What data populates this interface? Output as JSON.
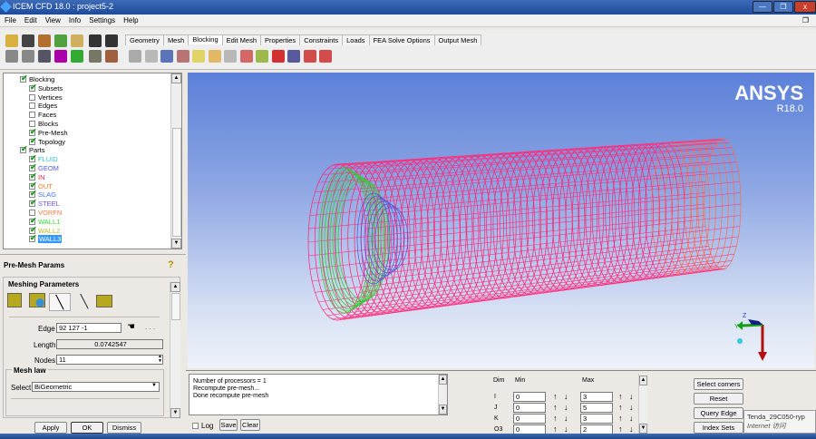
{
  "window": {
    "title": "ICEM CFD 18.0 : project5-2",
    "min": "—",
    "max": "❐",
    "close": "x"
  },
  "menu": [
    "File",
    "Edit",
    "View",
    "Info",
    "Settings",
    "Help"
  ],
  "tabs": [
    "Geometry",
    "Mesh",
    "Blocking",
    "Edit Mesh",
    "Properties",
    "Constraints",
    "Loads",
    "FEA Solve Options",
    "Output Mesh"
  ],
  "active_tab": "Blocking",
  "tree": {
    "blocking": {
      "label": "Blocking",
      "items": [
        {
          "label": "Subsets",
          "checked": true
        },
        {
          "label": "Vertices",
          "checked": false
        },
        {
          "label": "Edges",
          "checked": false
        },
        {
          "label": "Faces",
          "checked": false
        },
        {
          "label": "Blocks",
          "checked": false
        },
        {
          "label": "Pre-Mesh",
          "checked": true
        },
        {
          "label": "Topology",
          "checked": true
        }
      ]
    },
    "parts": {
      "label": "Parts",
      "items": [
        {
          "label": "FLUID",
          "checked": true,
          "color": "#33c0c0"
        },
        {
          "label": "GEOM",
          "checked": true,
          "color": "#5555ee"
        },
        {
          "label": "IN",
          "checked": true,
          "color": "#ee2255"
        },
        {
          "label": "OUT",
          "checked": true,
          "color": "#ff7733"
        },
        {
          "label": "SLAG",
          "checked": true,
          "color": "#4477ff"
        },
        {
          "label": "STEEL",
          "checked": true,
          "color": "#6655ff"
        },
        {
          "label": "VORFN",
          "checked": false,
          "color": "#ff7744"
        },
        {
          "label": "WALL1",
          "checked": true,
          "color": "#33dd33"
        },
        {
          "label": "WALL2",
          "checked": true,
          "color": "#bbbb22"
        },
        {
          "label": "WALL3",
          "checked": true,
          "color": "#ffffff"
        }
      ]
    }
  },
  "params": {
    "title": "Pre-Mesh Params",
    "help": "?",
    "section": "Meshing Parameters",
    "edge_label": "Edge",
    "edge": "92 127 -1",
    "dots": ". . .",
    "length_label": "Length",
    "length": "0.0742547",
    "nodes_label": "Nodes",
    "nodes": "11",
    "mesh_law": "Mesh law",
    "select_label": "Select",
    "select": "BiGeometric",
    "apply": "Apply",
    "ok": "OK",
    "dismiss": "Dismiss"
  },
  "viewport": {
    "brand": "ANSYS",
    "version": "R18.0",
    "axis_z": "Z",
    "axis_y": "Y"
  },
  "messages": [
    "Number of processors = 1",
    "Recompute pre-mesh...",
    "Done recompute pre-mesh"
  ],
  "log": {
    "log": "Log",
    "save": "Save",
    "clear": "Clear"
  },
  "dims": {
    "dim": "Dim",
    "min": "Min",
    "max": "Max",
    "rows": [
      {
        "d": "I",
        "min": "0",
        "max": "3"
      },
      {
        "d": "J",
        "min": "0",
        "max": "5"
      },
      {
        "d": "K",
        "min": "0",
        "max": "3"
      },
      {
        "d": "O3",
        "min": "0",
        "max": "2"
      }
    ]
  },
  "side_buttons": [
    "Select corners",
    "Reset",
    "Query Edge",
    "Index Sets"
  ],
  "tooltip": {
    "line1": "Tenda_29C050-ryp",
    "line2": "Internet 访问"
  }
}
